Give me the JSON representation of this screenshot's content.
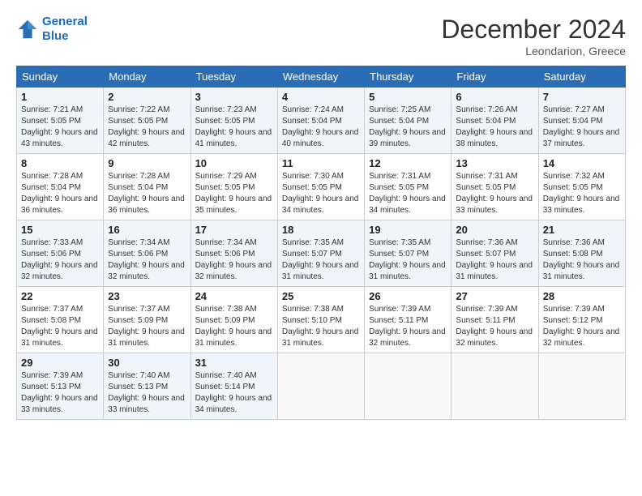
{
  "logo": {
    "line1": "General",
    "line2": "Blue"
  },
  "header": {
    "month_year": "December 2024",
    "location": "Leondarion, Greece"
  },
  "weekdays": [
    "Sunday",
    "Monday",
    "Tuesday",
    "Wednesday",
    "Thursday",
    "Friday",
    "Saturday"
  ],
  "weeks": [
    [
      {
        "day": "1",
        "sunrise": "7:21 AM",
        "sunset": "5:05 PM",
        "daylight": "9 hours and 43 minutes."
      },
      {
        "day": "2",
        "sunrise": "7:22 AM",
        "sunset": "5:05 PM",
        "daylight": "9 hours and 42 minutes."
      },
      {
        "day": "3",
        "sunrise": "7:23 AM",
        "sunset": "5:05 PM",
        "daylight": "9 hours and 41 minutes."
      },
      {
        "day": "4",
        "sunrise": "7:24 AM",
        "sunset": "5:04 PM",
        "daylight": "9 hours and 40 minutes."
      },
      {
        "day": "5",
        "sunrise": "7:25 AM",
        "sunset": "5:04 PM",
        "daylight": "9 hours and 39 minutes."
      },
      {
        "day": "6",
        "sunrise": "7:26 AM",
        "sunset": "5:04 PM",
        "daylight": "9 hours and 38 minutes."
      },
      {
        "day": "7",
        "sunrise": "7:27 AM",
        "sunset": "5:04 PM",
        "daylight": "9 hours and 37 minutes."
      }
    ],
    [
      {
        "day": "8",
        "sunrise": "7:28 AM",
        "sunset": "5:04 PM",
        "daylight": "9 hours and 36 minutes."
      },
      {
        "day": "9",
        "sunrise": "7:28 AM",
        "sunset": "5:04 PM",
        "daylight": "9 hours and 36 minutes."
      },
      {
        "day": "10",
        "sunrise": "7:29 AM",
        "sunset": "5:05 PM",
        "daylight": "9 hours and 35 minutes."
      },
      {
        "day": "11",
        "sunrise": "7:30 AM",
        "sunset": "5:05 PM",
        "daylight": "9 hours and 34 minutes."
      },
      {
        "day": "12",
        "sunrise": "7:31 AM",
        "sunset": "5:05 PM",
        "daylight": "9 hours and 34 minutes."
      },
      {
        "day": "13",
        "sunrise": "7:31 AM",
        "sunset": "5:05 PM",
        "daylight": "9 hours and 33 minutes."
      },
      {
        "day": "14",
        "sunrise": "7:32 AM",
        "sunset": "5:05 PM",
        "daylight": "9 hours and 33 minutes."
      }
    ],
    [
      {
        "day": "15",
        "sunrise": "7:33 AM",
        "sunset": "5:06 PM",
        "daylight": "9 hours and 32 minutes."
      },
      {
        "day": "16",
        "sunrise": "7:34 AM",
        "sunset": "5:06 PM",
        "daylight": "9 hours and 32 minutes."
      },
      {
        "day": "17",
        "sunrise": "7:34 AM",
        "sunset": "5:06 PM",
        "daylight": "9 hours and 32 minutes."
      },
      {
        "day": "18",
        "sunrise": "7:35 AM",
        "sunset": "5:07 PM",
        "daylight": "9 hours and 31 minutes."
      },
      {
        "day": "19",
        "sunrise": "7:35 AM",
        "sunset": "5:07 PM",
        "daylight": "9 hours and 31 minutes."
      },
      {
        "day": "20",
        "sunrise": "7:36 AM",
        "sunset": "5:07 PM",
        "daylight": "9 hours and 31 minutes."
      },
      {
        "day": "21",
        "sunrise": "7:36 AM",
        "sunset": "5:08 PM",
        "daylight": "9 hours and 31 minutes."
      }
    ],
    [
      {
        "day": "22",
        "sunrise": "7:37 AM",
        "sunset": "5:08 PM",
        "daylight": "9 hours and 31 minutes."
      },
      {
        "day": "23",
        "sunrise": "7:37 AM",
        "sunset": "5:09 PM",
        "daylight": "9 hours and 31 minutes."
      },
      {
        "day": "24",
        "sunrise": "7:38 AM",
        "sunset": "5:09 PM",
        "daylight": "9 hours and 31 minutes."
      },
      {
        "day": "25",
        "sunrise": "7:38 AM",
        "sunset": "5:10 PM",
        "daylight": "9 hours and 31 minutes."
      },
      {
        "day": "26",
        "sunrise": "7:39 AM",
        "sunset": "5:11 PM",
        "daylight": "9 hours and 32 minutes."
      },
      {
        "day": "27",
        "sunrise": "7:39 AM",
        "sunset": "5:11 PM",
        "daylight": "9 hours and 32 minutes."
      },
      {
        "day": "28",
        "sunrise": "7:39 AM",
        "sunset": "5:12 PM",
        "daylight": "9 hours and 32 minutes."
      }
    ],
    [
      {
        "day": "29",
        "sunrise": "7:39 AM",
        "sunset": "5:13 PM",
        "daylight": "9 hours and 33 minutes."
      },
      {
        "day": "30",
        "sunrise": "7:40 AM",
        "sunset": "5:13 PM",
        "daylight": "9 hours and 33 minutes."
      },
      {
        "day": "31",
        "sunrise": "7:40 AM",
        "sunset": "5:14 PM",
        "daylight": "9 hours and 34 minutes."
      },
      null,
      null,
      null,
      null
    ]
  ]
}
